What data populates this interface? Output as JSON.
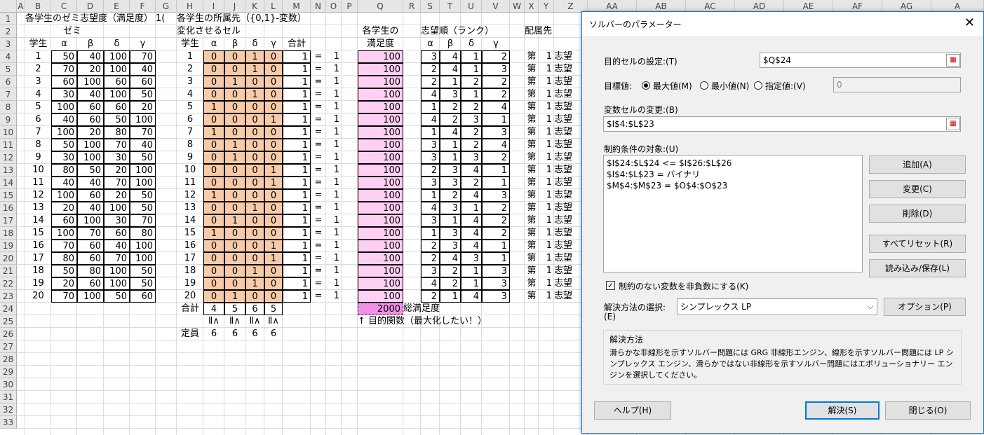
{
  "columns": [
    "A",
    "B",
    "C",
    "D",
    "E",
    "F",
    "G",
    "H",
    "I",
    "J",
    "K",
    "L",
    "M",
    "N",
    "O",
    "P",
    "Q",
    "R",
    "S",
    "T",
    "U",
    "V",
    "W",
    "X",
    "Y",
    "Z",
    "AA",
    "AB",
    "AC",
    "AD",
    "AE",
    "AF",
    "AG",
    "A"
  ],
  "rows": [
    "1",
    "2",
    "3",
    "4",
    "5",
    "6",
    "7",
    "8",
    "9",
    "10",
    "11",
    "12",
    "13",
    "14",
    "15",
    "16",
    "17",
    "18",
    "19",
    "20",
    "21",
    "22",
    "23",
    "24",
    "25",
    "26",
    "27",
    "28",
    "29",
    "30",
    "31",
    "32",
    "33"
  ],
  "texts": {
    "b1": "各学生のゼミ志望度（満足度）",
    "g1": "1(",
    "h1": "各学生の所属先（{0,1}-変数）",
    "c2": "ゼミ",
    "h2": "変化させるセル",
    "q2": "各学生の",
    "s2": "志望順（ランク）",
    "y2": "配属先",
    "b3": "学生",
    "h3": "学生",
    "m3": "合計",
    "q3": "満足度",
    "alpha": "α",
    "beta": "β",
    "delta": "δ",
    "gamma": "γ",
    "h24": "合計",
    "leq": "Ⅱ∧",
    "q24": "2000",
    "r24": "総満足度",
    "q25": "↑ 目的関数（最大化したい！）",
    "h26": "定員",
    "eq": "=",
    "dai": "第",
    "shibou": "志望"
  },
  "students": [
    1,
    2,
    3,
    4,
    5,
    6,
    7,
    8,
    9,
    10,
    11,
    12,
    13,
    14,
    15,
    16,
    17,
    18,
    19,
    20
  ],
  "pref": [
    [
      50,
      40,
      100,
      70
    ],
    [
      70,
      20,
      100,
      40
    ],
    [
      60,
      100,
      60,
      60
    ],
    [
      30,
      40,
      100,
      50
    ],
    [
      100,
      60,
      60,
      20
    ],
    [
      40,
      60,
      50,
      100
    ],
    [
      100,
      20,
      80,
      70
    ],
    [
      50,
      100,
      70,
      40
    ],
    [
      30,
      100,
      30,
      50
    ],
    [
      80,
      50,
      20,
      100
    ],
    [
      40,
      40,
      70,
      100
    ],
    [
      100,
      60,
      20,
      50
    ],
    [
      20,
      40,
      100,
      50
    ],
    [
      60,
      100,
      30,
      70
    ],
    [
      100,
      70,
      60,
      80
    ],
    [
      70,
      60,
      40,
      100
    ],
    [
      80,
      60,
      70,
      100
    ],
    [
      50,
      80,
      100,
      50
    ],
    [
      20,
      60,
      100,
      50
    ],
    [
      70,
      100,
      50,
      60
    ]
  ],
  "assign": [
    [
      0,
      0,
      1,
      0
    ],
    [
      0,
      0,
      1,
      0
    ],
    [
      0,
      1,
      0,
      0
    ],
    [
      0,
      0,
      1,
      0
    ],
    [
      1,
      0,
      0,
      0
    ],
    [
      0,
      0,
      0,
      1
    ],
    [
      1,
      0,
      0,
      0
    ],
    [
      0,
      1,
      0,
      0
    ],
    [
      0,
      1,
      0,
      0
    ],
    [
      0,
      0,
      0,
      1
    ],
    [
      0,
      0,
      0,
      1
    ],
    [
      1,
      0,
      0,
      0
    ],
    [
      0,
      0,
      1,
      0
    ],
    [
      0,
      1,
      0,
      0
    ],
    [
      1,
      0,
      0,
      0
    ],
    [
      0,
      0,
      0,
      1
    ],
    [
      0,
      0,
      0,
      1
    ],
    [
      0,
      0,
      1,
      0
    ],
    [
      0,
      0,
      1,
      0
    ],
    [
      0,
      1,
      0,
      0
    ]
  ],
  "row_total": [
    1,
    1,
    1,
    1,
    1,
    1,
    1,
    1,
    1,
    1,
    1,
    1,
    1,
    1,
    1,
    1,
    1,
    1,
    1,
    1
  ],
  "rhs": [
    1,
    1,
    1,
    1,
    1,
    1,
    1,
    1,
    1,
    1,
    1,
    1,
    1,
    1,
    1,
    1,
    1,
    1,
    1,
    1
  ],
  "satisfaction": [
    100,
    100,
    100,
    100,
    100,
    100,
    100,
    100,
    100,
    100,
    100,
    100,
    100,
    100,
    100,
    100,
    100,
    100,
    100,
    100
  ],
  "rank": [
    [
      3,
      4,
      1,
      2
    ],
    [
      2,
      4,
      1,
      3
    ],
    [
      2,
      1,
      2,
      2
    ],
    [
      4,
      3,
      1,
      2
    ],
    [
      1,
      2,
      2,
      4
    ],
    [
      4,
      2,
      3,
      1
    ],
    [
      1,
      4,
      2,
      3
    ],
    [
      3,
      1,
      2,
      4
    ],
    [
      3,
      1,
      3,
      2
    ],
    [
      2,
      3,
      4,
      1
    ],
    [
      3,
      3,
      2,
      1
    ],
    [
      1,
      2,
      4,
      3
    ],
    [
      4,
      3,
      1,
      2
    ],
    [
      3,
      1,
      4,
      2
    ],
    [
      1,
      3,
      4,
      2
    ],
    [
      2,
      3,
      4,
      1
    ],
    [
      2,
      4,
      3,
      1
    ],
    [
      3,
      2,
      1,
      3
    ],
    [
      4,
      2,
      1,
      3
    ],
    [
      2,
      1,
      4,
      3
    ]
  ],
  "placement": [
    1,
    1,
    1,
    1,
    1,
    1,
    1,
    1,
    1,
    1,
    1,
    1,
    1,
    1,
    1,
    1,
    1,
    1,
    1,
    1
  ],
  "col_total": [
    4,
    5,
    6,
    5
  ],
  "capacity": [
    6,
    6,
    6,
    6
  ],
  "dialog": {
    "title": "ソルバーのパラメーター",
    "close": "✕",
    "objective_label": "目的セルの設定:(T)",
    "objective_value": "$Q$24",
    "target_label": "目標値:",
    "opt_max": "最大値(M)",
    "opt_min": "最小値(N)",
    "opt_value": "指定値:(V)",
    "value_field": "0",
    "changing_label": "変数セルの変更:(B)",
    "changing_value": "$I$4:$L$23",
    "constraints_label": "制約条件の対象:(U)",
    "constraints": [
      "$I$24:$L$24 <= $I$26:$L$26",
      "$I$4:$L$23 = バイナリ",
      "$M$4:$M$23 = $O$4:$O$23"
    ],
    "btn_add": "追加(A)",
    "btn_change": "変更(C)",
    "btn_delete": "削除(D)",
    "btn_reset": "すべてリセット(R)",
    "btn_load": "読み込み/保存(L)",
    "nonneg_label": "制約のない変数を非負数にする(K)",
    "method_label": "解決方法の選択:",
    "method_label2": "(E)",
    "method_value": "シンプレックス LP",
    "btn_options": "オプション(P)",
    "method_group": "解決方法",
    "method_desc": "滑らかな非線形を示すソルバー問題には GRG 非線形エンジン、線形を示すソルバー問題には LP シンプレックス エンジン、滑らかではない非線形を示すソルバー問題にはエボリューショナリー エンジンを選択してください。",
    "btn_help": "ヘルプ(H)",
    "btn_solve": "解決(S)",
    "btn_close": "閉じる(O)"
  }
}
